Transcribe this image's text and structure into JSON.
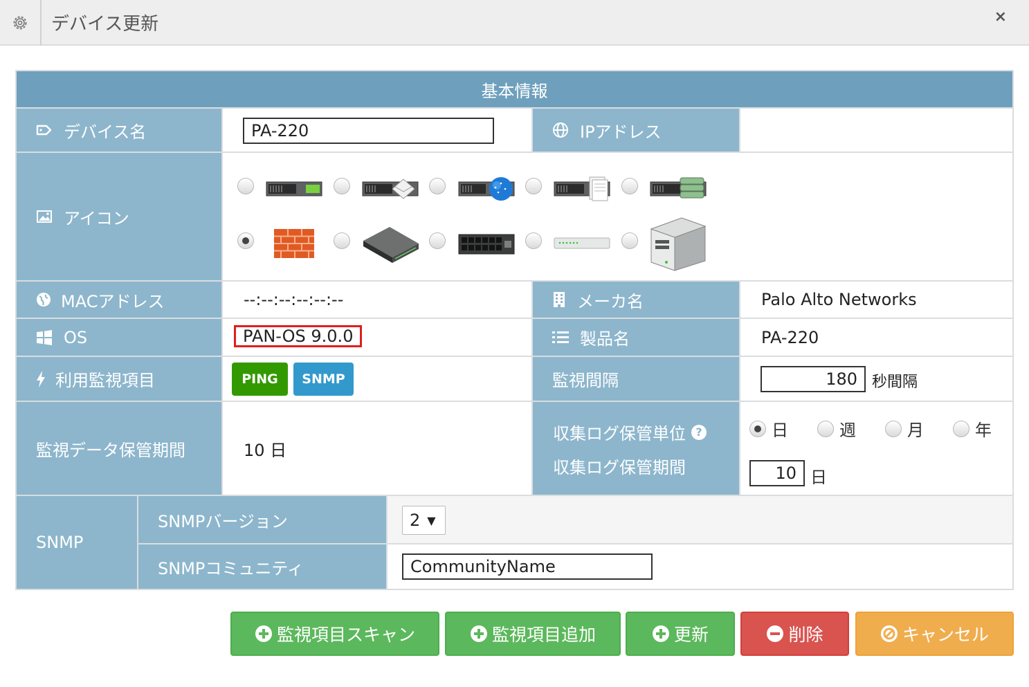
{
  "window": {
    "title": "デバイス更新",
    "close": "×"
  },
  "section_header": "基本情報",
  "device_name": {
    "label": "デバイス名",
    "value": "PA-220"
  },
  "ip_address": {
    "label": "IPアドレス",
    "value": ""
  },
  "icon": {
    "label": "アイコン",
    "selected_index": 5,
    "options": [
      "server-green",
      "server-mail",
      "server-globe",
      "server-doc",
      "server-db",
      "firewall",
      "rack-switch",
      "switch",
      "hub",
      "tower-server"
    ]
  },
  "mac_address": {
    "label": "MACアドレス",
    "value": "--:--:--:--:--:--"
  },
  "maker": {
    "label": "メーカ名",
    "value": "Palo Alto Networks"
  },
  "os": {
    "label": "OS",
    "value": "PAN-OS 9.0.0"
  },
  "product": {
    "label": "製品名",
    "value": "PA-220"
  },
  "monitor_items": {
    "label": "利用監視項目",
    "badges": [
      "PING",
      "SNMP"
    ]
  },
  "interval": {
    "label": "監視間隔",
    "value": "180",
    "unit": "秒間隔"
  },
  "retention": {
    "label": "監視データ保管期間",
    "value": "10 日"
  },
  "log_unit": {
    "label": "収集ログ保管単位",
    "help": "?",
    "options": [
      "日",
      "週",
      "月",
      "年"
    ],
    "selected": "日"
  },
  "log_period": {
    "label": "収集ログ保管期間",
    "value": "10",
    "unit": "日"
  },
  "snmp": {
    "label": "SNMP",
    "version_label": "SNMPバージョン",
    "version_value": "2",
    "version_arrow": "▼",
    "community_label": "SNMPコミュニティ",
    "community_value": "CommunityName"
  },
  "buttons": {
    "scan": "監視項目スキャン",
    "add": "監視項目追加",
    "update": "更新",
    "delete": "削除",
    "cancel": "キャンセル"
  },
  "colors": {
    "header": "#6ea0bd",
    "label": "#8db6cc",
    "ping": "#339900",
    "snmp": "#3399cc",
    "green": "#5cb85c",
    "red": "#d9534f",
    "orange": "#f0ad4e"
  }
}
